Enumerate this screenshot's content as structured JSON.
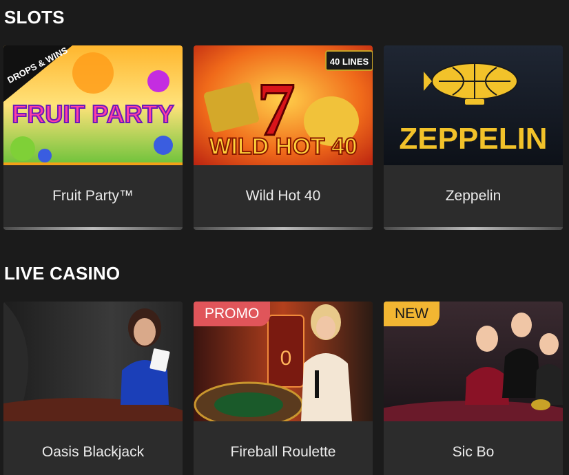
{
  "sections": [
    {
      "title": "SLOTS",
      "games": [
        {
          "name": "Fruit Party™",
          "art_text": "FRUIT PARTY",
          "corner_text": "DROPS & WINS"
        },
        {
          "name": "Wild Hot 40",
          "art_text": "WILD HOT 40",
          "corner_text": "40 LINES"
        },
        {
          "name": "Zeppelin",
          "art_text": "ZEPPELIN"
        }
      ]
    },
    {
      "title": "LIVE CASINO",
      "games": [
        {
          "name": "Oasis Blackjack"
        },
        {
          "name": "Fireball Roulette",
          "badge": "PROMO"
        },
        {
          "name": "Sic Bo",
          "badge": "NEW"
        }
      ]
    }
  ],
  "colors": {
    "background": "#1b1b1b",
    "card": "#2c2c2c",
    "promo_badge": "#e0555a",
    "new_badge": "#f2b632"
  }
}
